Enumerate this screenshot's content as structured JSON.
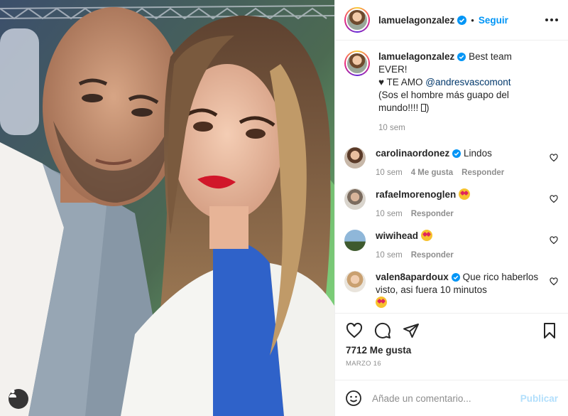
{
  "post": {
    "username": "lamuelagonzalez",
    "follow_label": "Seguir",
    "separator": "•"
  },
  "caption": {
    "username": "lamuelagonzalez",
    "line1": "Best team EVER!",
    "line2_prefix": "♥ TE AMO ",
    "mention": "@andresvascomont",
    "line3": "(Sos el hombre más guapo del mundo!!!! ",
    "line3_suffix": ")",
    "time": "10 sem"
  },
  "comments": [
    {
      "username": "carolinaordonez",
      "verified": true,
      "text": "Lindos",
      "time": "10 sem",
      "likes": "4 Me gusta",
      "reply": "Responder"
    },
    {
      "username": "rafaelmorenoglen",
      "verified": false,
      "text": "",
      "emoji": "star-struck",
      "time": "10 sem",
      "reply": "Responder"
    },
    {
      "username": "wiwihead",
      "verified": false,
      "text": "",
      "emoji": "star-struck",
      "time": "10 sem",
      "reply": "Responder"
    },
    {
      "username": "valen8apardoux",
      "verified": true,
      "text": "Que rico haberlos visto, asi fuera 10 minutos",
      "emoji": "star-struck"
    }
  ],
  "actions": {
    "likes": "7712 Me gusta",
    "date": "MARZO 16"
  },
  "add_comment": {
    "placeholder": "Añade un comentario...",
    "publish": "Publicar"
  },
  "colors": {
    "accent": "#0095f6",
    "publish_disabled": "#b2dffc",
    "muted": "#8e8e8e",
    "text": "#262626",
    "border": "#efefef"
  }
}
